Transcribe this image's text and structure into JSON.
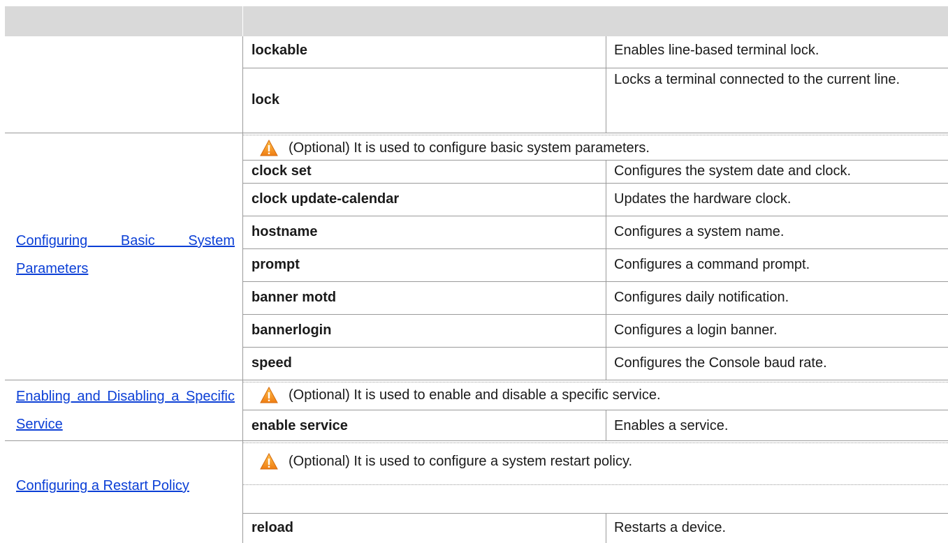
{
  "header": {
    "col1": "",
    "col2": ""
  },
  "lock_group": {
    "rows": [
      {
        "command": "lockable",
        "description": "Enables line-based terminal lock."
      },
      {
        "command": "lock",
        "description": "Locks a terminal connected to the current line."
      }
    ]
  },
  "basic_params": {
    "link": "Configuring Basic System Parameters",
    "note": "(Optional) It is used to configure basic system parameters.",
    "rows": [
      {
        "command": "clock set",
        "description": "Configures the system date and clock."
      },
      {
        "command": "clock update-calendar",
        "description": "Updates the hardware clock."
      },
      {
        "command": "hostname",
        "description": "Configures a system name."
      },
      {
        "command": "prompt",
        "description": "Configures a command prompt."
      },
      {
        "command": "banner motd",
        "description": "Configures daily notification."
      },
      {
        "command": "bannerlogin",
        "description": "Configures a login banner."
      },
      {
        "command": "speed",
        "description": "Configures the Console baud rate."
      }
    ]
  },
  "service": {
    "link": "Enabling and Disabling a Specific Service",
    "note": "(Optional) It is used to enable and disable a specific service.",
    "rows": [
      {
        "command": "enable service",
        "description": "Enables a service."
      }
    ]
  },
  "restart": {
    "link": "Configuring a Restart Policy",
    "note": "(Optional) It is used to configure a system restart policy.",
    "rows": [
      {
        "command": "reload",
        "description": "Restarts a device."
      }
    ]
  },
  "icons": {
    "warning": "warning-triangle-icon"
  },
  "colors": {
    "link": "#0b3fd6",
    "header_bg": "#d9d9d9",
    "warning": "#f08a1c"
  }
}
